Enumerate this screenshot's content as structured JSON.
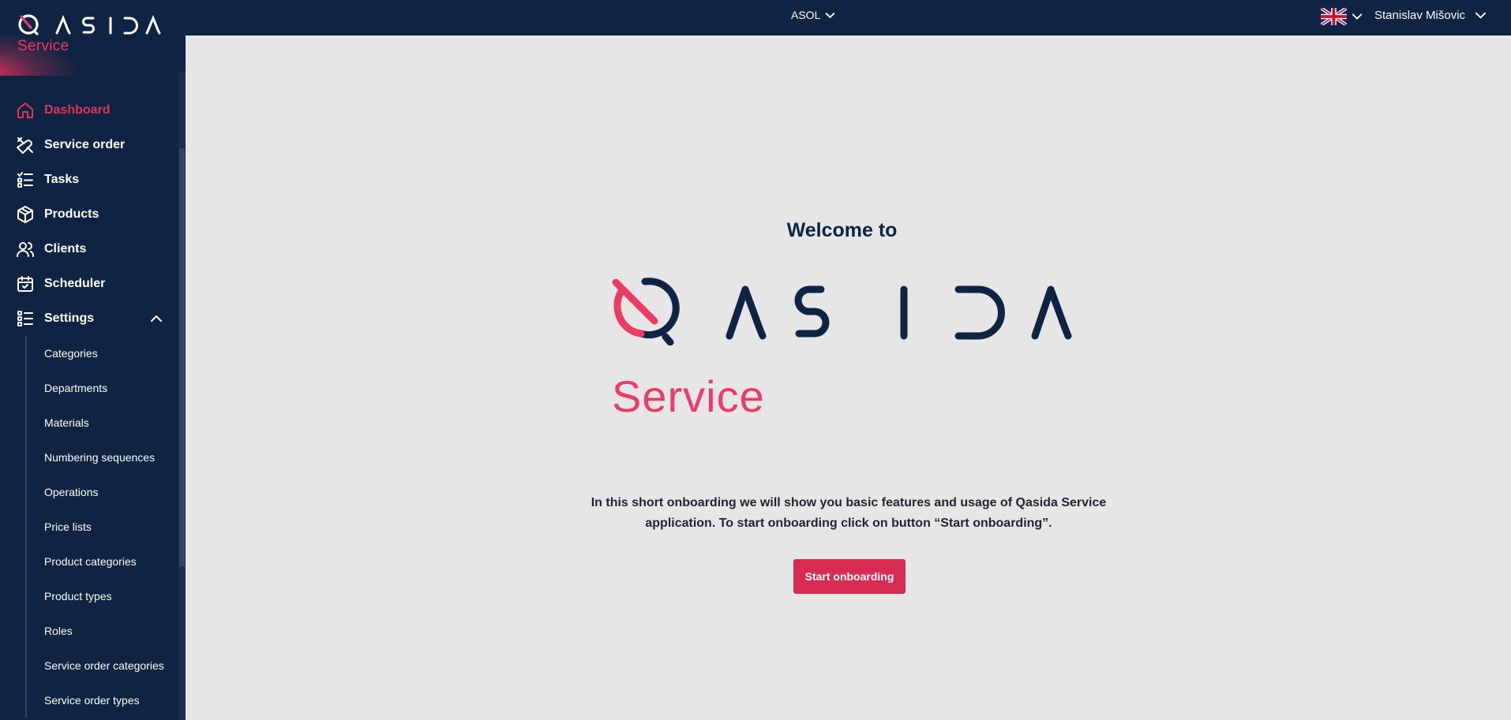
{
  "brand": {
    "name": "QASIDA",
    "product": "Service",
    "accent_color": "#e3345c",
    "navy_color": "#0f2442"
  },
  "topbar": {
    "company": "ASOL",
    "language_flag": "uk-flag-icon",
    "user_name": "Stanislav Mišovic"
  },
  "sidebar": {
    "items": [
      {
        "label": "Dashboard",
        "icon": "home-icon",
        "active": true
      },
      {
        "label": "Service order",
        "icon": "tools-icon"
      },
      {
        "label": "Tasks",
        "icon": "task-list-icon"
      },
      {
        "label": "Products",
        "icon": "box-icon"
      },
      {
        "label": "Clients",
        "icon": "users-icon"
      },
      {
        "label": "Scheduler",
        "icon": "calendar-check-icon"
      },
      {
        "label": "Settings",
        "icon": "settings-list-icon",
        "expanded": true
      }
    ],
    "settings_sub": [
      "Categories",
      "Departments",
      "Materials",
      "Numbering sequences",
      "Operations",
      "Price lists",
      "Product categories",
      "Product types",
      "Roles",
      "Service order categories",
      "Service order types"
    ]
  },
  "main": {
    "welcome": "Welcome to",
    "logo_text": "QASIDA",
    "logo_sub": "Service",
    "intro_text": "In this short onboarding we will show you basic features and usage of Qasida Service application. To start onboarding click on button “Start onboarding”.",
    "start_button": "Start onboarding"
  }
}
